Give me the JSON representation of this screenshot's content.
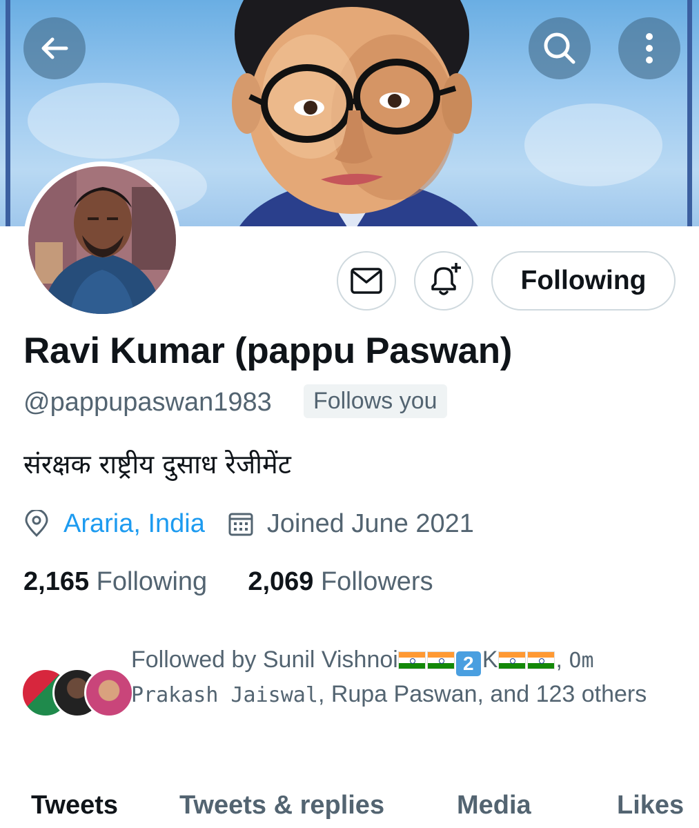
{
  "header": {
    "back_icon": "back-arrow-icon",
    "search_icon": "search-icon",
    "more_icon": "more-vertical-icon"
  },
  "profile": {
    "name": "Ravi Kumar (pappu Paswan)",
    "handle": "@pappupaswan1983",
    "follows_you": "Follows you",
    "bio": "संरक्षक राष्ट्रीय दुसाध रेजीमेंट",
    "location": "Araria, India",
    "joined": "Joined June 2021"
  },
  "actions": {
    "message_icon": "mail-icon",
    "notify_icon": "bell-plus-icon",
    "following_label": "Following"
  },
  "stats": {
    "following_count": "2,165",
    "following_label": "Following",
    "followers_count": "2,069",
    "followers_label": "Followers"
  },
  "followed_by": {
    "prefix": "Followed by Sunil Vishnoi",
    "name_part": "K",
    "keycap": "2",
    "sep": ", ",
    "om": "Om",
    "prakash": "Prakash Jaiswal",
    "rest": ", Rupa Paswan, and 123 others"
  },
  "tabs": [
    {
      "label": "Tweets",
      "active": true
    },
    {
      "label": "Tweets & replies",
      "active": false
    },
    {
      "label": "Media",
      "active": false
    },
    {
      "label": "Likes",
      "active": false
    }
  ],
  "colors": {
    "accent": "#1d9bf0",
    "text": "#0f1419",
    "secondary": "#536471",
    "border": "#cfd9de"
  }
}
